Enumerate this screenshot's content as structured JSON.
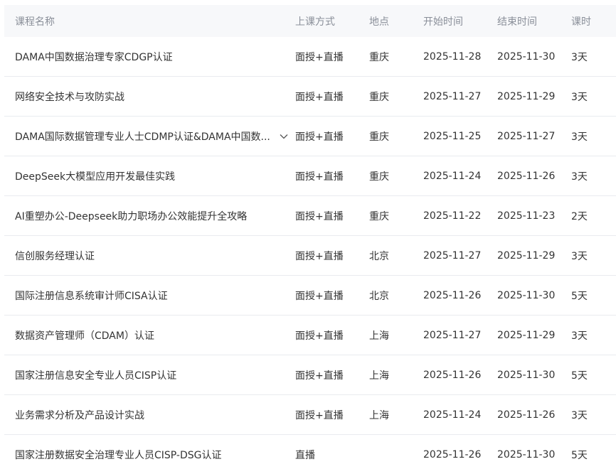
{
  "table": {
    "headers": {
      "name": "课程名称",
      "mode": "上课方式",
      "location": "地点",
      "start": "开始时间",
      "end": "结束时间",
      "days": "课时"
    },
    "rows": [
      {
        "name": "DAMA中国数据治理专家CDGP认证",
        "mode": "面授+直播",
        "location": "重庆",
        "start": "2025-11-28",
        "end": "2025-11-30",
        "days": "3天"
      },
      {
        "name": "网络安全技术与攻防实战",
        "mode": "面授+直播",
        "location": "重庆",
        "start": "2025-11-27",
        "end": "2025-11-29",
        "days": "3天"
      },
      {
        "name": "DAMA国际数据管理专业人士CDMP认证&DAMA中国数...",
        "mode": "面授+直播",
        "location": "重庆",
        "start": "2025-11-25",
        "end": "2025-11-27",
        "days": "3天",
        "expandable": true
      },
      {
        "name": "DeepSeek大模型应用开发最佳实践",
        "mode": "面授+直播",
        "location": "重庆",
        "start": "2025-11-24",
        "end": "2025-11-26",
        "days": "3天"
      },
      {
        "name": "AI重塑办公-Deepseek助力职场办公效能提升全攻略",
        "mode": "面授+直播",
        "location": "重庆",
        "start": "2025-11-22",
        "end": "2025-11-23",
        "days": "2天"
      },
      {
        "name": "信创服务经理认证",
        "mode": "面授+直播",
        "location": "北京",
        "start": "2025-11-27",
        "end": "2025-11-29",
        "days": "3天"
      },
      {
        "name": "国际注册信息系统审计师CISA认证",
        "mode": "面授+直播",
        "location": "北京",
        "start": "2025-11-26",
        "end": "2025-11-30",
        "days": "5天"
      },
      {
        "name": "数据资产管理师（CDAM）认证",
        "mode": "面授+直播",
        "location": "上海",
        "start": "2025-11-27",
        "end": "2025-11-29",
        "days": "3天"
      },
      {
        "name": "国家注册信息安全专业人员CISP认证",
        "mode": "面授+直播",
        "location": "上海",
        "start": "2025-11-26",
        "end": "2025-11-30",
        "days": "5天"
      },
      {
        "name": "业务需求分析及产品设计实战",
        "mode": "面授+直播",
        "location": "上海",
        "start": "2025-11-24",
        "end": "2025-11-26",
        "days": "3天"
      },
      {
        "name": "国家注册数据安全治理专业人员CISP-DSG认证",
        "mode": "直播",
        "location": "",
        "start": "2025-11-26",
        "end": "2025-11-30",
        "days": "5天"
      }
    ]
  },
  "icons": {
    "expand": "chevron-down-icon"
  },
  "colors": {
    "header_bg": "#f7f8fa",
    "header_text": "#8a8f99",
    "body_text": "#333333",
    "divider": "#e9ebef"
  }
}
